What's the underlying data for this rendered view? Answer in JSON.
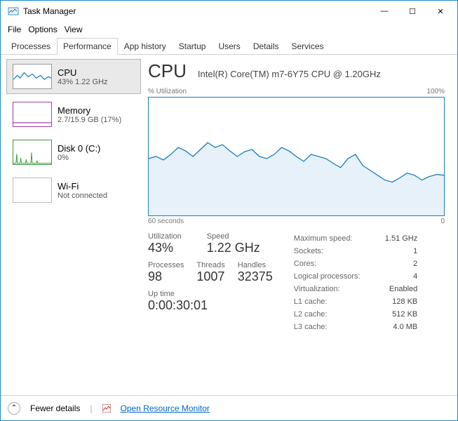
{
  "window": {
    "title": "Task Manager",
    "min_glyph": "—",
    "max_glyph": "☐",
    "close_glyph": "✕"
  },
  "menu": {
    "file": "File",
    "options": "Options",
    "view": "View"
  },
  "tabs": [
    "Processes",
    "Performance",
    "App history",
    "Startup",
    "Users",
    "Details",
    "Services"
  ],
  "active_tab": "Performance",
  "sidebar": {
    "items": [
      {
        "name": "CPU",
        "sub": "43%  1.22 GHz",
        "active": true
      },
      {
        "name": "Memory",
        "sub": "2.7/15.9 GB (17%)",
        "active": false
      },
      {
        "name": "Disk 0 (C:)",
        "sub": "0%",
        "active": false
      },
      {
        "name": "Wi-Fi",
        "sub": "Not connected",
        "active": false
      }
    ]
  },
  "detail": {
    "title": "CPU",
    "subtitle": "Intel(R) Core(TM) m7-6Y75 CPU @ 1.20GHz",
    "chart_top_left": "% Utilization",
    "chart_top_right": "100%",
    "chart_bottom_left": "60 seconds",
    "chart_bottom_right": "0",
    "stats_left": {
      "utilization_label": "Utilization",
      "utilization": "43%",
      "speed_label": "Speed",
      "speed": "1.22 GHz",
      "processes_label": "Processes",
      "processes": "98",
      "threads_label": "Threads",
      "threads": "1007",
      "handles_label": "Handles",
      "handles": "32375",
      "uptime_label": "Up time",
      "uptime": "0:00:30:01"
    },
    "stats_right": {
      "max_speed_l": "Maximum speed:",
      "max_speed": "1.51 GHz",
      "sockets_l": "Sockets:",
      "sockets": "1",
      "cores_l": "Cores:",
      "cores": "2",
      "lp_l": "Logical processors:",
      "lp": "4",
      "virt_l": "Virtualization:",
      "virt": "Enabled",
      "l1_l": "L1 cache:",
      "l1": "128 KB",
      "l2_l": "L2 cache:",
      "l2": "512 KB",
      "l3_l": "L3 cache:",
      "l3": "4.0 MB"
    }
  },
  "footer": {
    "fewer": "Fewer details",
    "link": "Open Resource Monitor"
  },
  "chart_data": {
    "type": "area",
    "title": "CPU % Utilization",
    "xlabel": "seconds ago",
    "ylabel": "% Utilization",
    "ylim": [
      0,
      100
    ],
    "x_range_seconds": [
      60,
      0
    ],
    "values_percent": [
      48,
      50,
      47,
      52,
      58,
      55,
      50,
      56,
      62,
      58,
      60,
      55,
      50,
      54,
      56,
      50,
      48,
      52,
      58,
      55,
      50,
      46,
      52,
      50,
      48,
      44,
      40,
      48,
      52,
      42,
      38,
      34,
      30,
      28,
      32,
      36,
      34,
      30,
      33,
      35,
      34,
      34
    ]
  }
}
